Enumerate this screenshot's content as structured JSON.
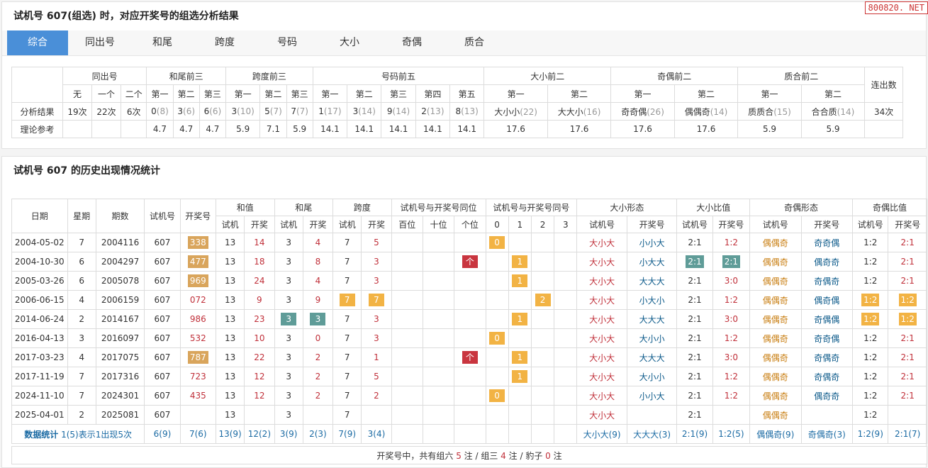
{
  "watermark": "800820. NET",
  "top_title": "试机号 607(组选) 时，对应开奖号的组选分析结果",
  "tabs": [
    "综合",
    "同出号",
    "和尾",
    "跨度",
    "号码",
    "大小",
    "奇偶",
    "质合"
  ],
  "summary": {
    "groups": [
      "同出号",
      "和尾前三",
      "跨度前三",
      "号码前五",
      "大小前二",
      "奇偶前二",
      "质合前二",
      "连出数"
    ],
    "sub_tongchu": [
      "无",
      "一个",
      "二个"
    ],
    "sub_ordinals": [
      "第一",
      "第二",
      "第三",
      "第四",
      "第五"
    ],
    "row_result_label": "分析结果",
    "row_ref_label": "理论参考",
    "tongchu_result": [
      "19次",
      "22次",
      "6次"
    ],
    "hewei": [
      {
        "v": "0",
        "c": "8"
      },
      {
        "v": "3",
        "c": "6"
      },
      {
        "v": "6",
        "c": "6"
      }
    ],
    "kuadu": [
      {
        "v": "3",
        "c": "10"
      },
      {
        "v": "5",
        "c": "7"
      },
      {
        "v": "7",
        "c": "7"
      }
    ],
    "haoma": [
      {
        "v": "1",
        "c": "17"
      },
      {
        "v": "3",
        "c": "14"
      },
      {
        "v": "9",
        "c": "14"
      },
      {
        "v": "2",
        "c": "13"
      },
      {
        "v": "8",
        "c": "13"
      }
    ],
    "daxiao": [
      {
        "v": "大小小",
        "c": "22"
      },
      {
        "v": "大大小",
        "c": "16"
      }
    ],
    "jiou": [
      {
        "v": "奇奇偶",
        "c": "26"
      },
      {
        "v": "偶偶奇",
        "c": "14"
      }
    ],
    "zhihe": [
      {
        "v": "质质合",
        "c": "15"
      },
      {
        "v": "合合质",
        "c": "14"
      }
    ],
    "lianchu": "34次",
    "ref": [
      "4.7",
      "4.7",
      "4.7",
      "5.9",
      "7.1",
      "5.9",
      "14.1",
      "14.1",
      "14.1",
      "14.1",
      "14.1",
      "17.6",
      "17.6",
      "17.6",
      "17.6",
      "5.9",
      "5.9"
    ]
  },
  "hist_title": "试机号 607 的历史出现情况统计",
  "hist": {
    "headers": {
      "date": "日期",
      "week": "星期",
      "issue": "期数",
      "sjh": "试机号",
      "kjh": "开奖号",
      "hezhi": "和值",
      "hewei": "和尾",
      "kuadu": "跨度",
      "tongwei": "试机号与开奖号同位",
      "tonghao": "试机号与开奖号同号",
      "dxxt": "大小形态",
      "dxbz": "大小比值",
      "joxt": "奇偶形态",
      "jobz": "奇偶比值",
      "sub_sj": "试机",
      "sub_kj": "开奖",
      "sub_sjh": "试机号",
      "sub_kjh": "开奖号",
      "pos": [
        "百位",
        "十位",
        "个位"
      ],
      "cnt": [
        "0",
        "1",
        "2",
        "3"
      ]
    },
    "rows": [
      {
        "date": "2004-05-02",
        "week": "7",
        "issue": "2004116",
        "sjh": "607",
        "kjh": "338",
        "kjh_hl": true,
        "hz_sj": "13",
        "hz_kj": "14",
        "hw_sj": "3",
        "hw_sj_hl": false,
        "hw_kj": "4",
        "hw_kj_hl": false,
        "kd_sj": "7",
        "kd_sj_hl": false,
        "kd_kj": "5",
        "kd_kj_hl": false,
        "pos": [
          "",
          "",
          ""
        ],
        "cnt_idx": 0,
        "dx_sj": "大小大",
        "dx_kj": "小小大",
        "dxb_sj": "2:1",
        "dxb_kj": "1:2",
        "dxb_hl": false,
        "jo_sj": "偶偶奇",
        "jo_kj": "奇奇偶",
        "job_sj": "1:2",
        "job_kj": "2:1",
        "job_hl": false
      },
      {
        "date": "2004-10-30",
        "week": "6",
        "issue": "2004297",
        "sjh": "607",
        "kjh": "477",
        "kjh_hl": true,
        "hz_sj": "13",
        "hz_kj": "18",
        "hw_sj": "3",
        "hw_sj_hl": false,
        "hw_kj": "8",
        "hw_kj_hl": false,
        "kd_sj": "7",
        "kd_sj_hl": false,
        "kd_kj": "3",
        "kd_kj_hl": false,
        "pos": [
          "",
          "",
          "个"
        ],
        "cnt_idx": 1,
        "dx_sj": "大小大",
        "dx_kj": "小大大",
        "dxb_sj": "2:1",
        "dxb_kj": "2:1",
        "dxb_hl": true,
        "jo_sj": "偶偶奇",
        "jo_kj": "偶奇奇",
        "job_sj": "1:2",
        "job_kj": "2:1",
        "job_hl": false
      },
      {
        "date": "2005-03-26",
        "week": "6",
        "issue": "2005078",
        "sjh": "607",
        "kjh": "969",
        "kjh_hl": true,
        "hz_sj": "13",
        "hz_kj": "24",
        "hw_sj": "3",
        "hw_sj_hl": false,
        "hw_kj": "4",
        "hw_kj_hl": false,
        "kd_sj": "7",
        "kd_sj_hl": false,
        "kd_kj": "3",
        "kd_kj_hl": false,
        "pos": [
          "",
          "",
          ""
        ],
        "cnt_idx": 1,
        "dx_sj": "大小大",
        "dx_kj": "大大大",
        "dxb_sj": "2:1",
        "dxb_kj": "3:0",
        "dxb_hl": false,
        "jo_sj": "偶偶奇",
        "jo_kj": "奇偶奇",
        "job_sj": "1:2",
        "job_kj": "2:1",
        "job_hl": false
      },
      {
        "date": "2006-06-15",
        "week": "4",
        "issue": "2006159",
        "sjh": "607",
        "kjh": "072",
        "kjh_hl": false,
        "hz_sj": "13",
        "hz_kj": "9",
        "hw_sj": "3",
        "hw_sj_hl": false,
        "hw_kj": "9",
        "hw_kj_hl": false,
        "kd_sj": "7",
        "kd_sj_hl": true,
        "kd_kj": "7",
        "kd_kj_hl": true,
        "pos": [
          "",
          "",
          ""
        ],
        "cnt_idx": 2,
        "dx_sj": "大小大",
        "dx_kj": "小大小",
        "dxb_sj": "2:1",
        "dxb_kj": "1:2",
        "dxb_hl": false,
        "jo_sj": "偶偶奇",
        "jo_kj": "偶奇偶",
        "job_sj": "1:2",
        "job_kj": "1:2",
        "job_hl": true
      },
      {
        "date": "2014-06-24",
        "week": "2",
        "issue": "2014167",
        "sjh": "607",
        "kjh": "986",
        "kjh_hl": false,
        "hz_sj": "13",
        "hz_kj": "23",
        "hw_sj": "3",
        "hw_sj_hl": true,
        "hw_kj": "3",
        "hw_kj_hl": true,
        "kd_sj": "7",
        "kd_sj_hl": false,
        "kd_kj": "3",
        "kd_kj_hl": false,
        "pos": [
          "",
          "",
          ""
        ],
        "cnt_idx": 1,
        "dx_sj": "大小大",
        "dx_kj": "大大大",
        "dxb_sj": "2:1",
        "dxb_kj": "3:0",
        "dxb_hl": false,
        "jo_sj": "偶偶奇",
        "jo_kj": "奇偶偶",
        "job_sj": "1:2",
        "job_kj": "1:2",
        "job_hl": true
      },
      {
        "date": "2016-04-13",
        "week": "3",
        "issue": "2016097",
        "sjh": "607",
        "kjh": "532",
        "kjh_hl": false,
        "hz_sj": "13",
        "hz_kj": "10",
        "hw_sj": "3",
        "hw_sj_hl": false,
        "hw_kj": "0",
        "hw_kj_hl": false,
        "kd_sj": "7",
        "kd_sj_hl": false,
        "kd_kj": "3",
        "kd_kj_hl": false,
        "pos": [
          "",
          "",
          ""
        ],
        "cnt_idx": 0,
        "dx_sj": "大小大",
        "dx_kj": "大小小",
        "dxb_sj": "2:1",
        "dxb_kj": "1:2",
        "dxb_hl": false,
        "jo_sj": "偶偶奇",
        "jo_kj": "奇奇偶",
        "job_sj": "1:2",
        "job_kj": "2:1",
        "job_hl": false
      },
      {
        "date": "2017-03-23",
        "week": "4",
        "issue": "2017075",
        "sjh": "607",
        "kjh": "787",
        "kjh_hl": true,
        "hz_sj": "13",
        "hz_kj": "22",
        "hw_sj": "3",
        "hw_sj_hl": false,
        "hw_kj": "2",
        "hw_kj_hl": false,
        "kd_sj": "7",
        "kd_sj_hl": false,
        "kd_kj": "1",
        "kd_kj_hl": false,
        "pos": [
          "",
          "",
          "个"
        ],
        "cnt_idx": 1,
        "dx_sj": "大小大",
        "dx_kj": "大大大",
        "dxb_sj": "2:1",
        "dxb_kj": "3:0",
        "dxb_hl": false,
        "jo_sj": "偶偶奇",
        "jo_kj": "奇偶奇",
        "job_sj": "1:2",
        "job_kj": "2:1",
        "job_hl": false
      },
      {
        "date": "2017-11-19",
        "week": "7",
        "issue": "2017316",
        "sjh": "607",
        "kjh": "723",
        "kjh_hl": false,
        "hz_sj": "13",
        "hz_kj": "12",
        "hw_sj": "3",
        "hw_sj_hl": false,
        "hw_kj": "2",
        "hw_kj_hl": false,
        "kd_sj": "7",
        "kd_sj_hl": false,
        "kd_kj": "5",
        "kd_kj_hl": false,
        "pos": [
          "",
          "",
          ""
        ],
        "cnt_idx": 1,
        "dx_sj": "大小大",
        "dx_kj": "大小小",
        "dxb_sj": "2:1",
        "dxb_kj": "1:2",
        "dxb_hl": false,
        "jo_sj": "偶偶奇",
        "jo_kj": "奇偶奇",
        "job_sj": "1:2",
        "job_kj": "2:1",
        "job_hl": false
      },
      {
        "date": "2024-11-10",
        "week": "7",
        "issue": "2024301",
        "sjh": "607",
        "kjh": "435",
        "kjh_hl": false,
        "hz_sj": "13",
        "hz_kj": "12",
        "hw_sj": "3",
        "hw_sj_hl": false,
        "hw_kj": "2",
        "hw_kj_hl": false,
        "kd_sj": "7",
        "kd_sj_hl": false,
        "kd_kj": "2",
        "kd_kj_hl": false,
        "pos": [
          "",
          "",
          ""
        ],
        "cnt_idx": 0,
        "dx_sj": "大小大",
        "dx_kj": "小小大",
        "dxb_sj": "2:1",
        "dxb_kj": "1:2",
        "dxb_hl": false,
        "jo_sj": "偶偶奇",
        "jo_kj": "偶奇奇",
        "job_sj": "1:2",
        "job_kj": "2:1",
        "job_hl": false
      },
      {
        "date": "2025-04-01",
        "week": "2",
        "issue": "2025081",
        "sjh": "607",
        "kjh": "",
        "kjh_hl": false,
        "hz_sj": "13",
        "hz_kj": "",
        "hw_sj": "3",
        "hw_sj_hl": false,
        "hw_kj": "",
        "hw_kj_hl": false,
        "kd_sj": "7",
        "kd_sj_hl": false,
        "kd_kj": "",
        "kd_kj_hl": false,
        "pos": [
          "",
          "",
          ""
        ],
        "cnt_idx": -1,
        "dx_sj": "大小大",
        "dx_kj": "",
        "dxb_sj": "2:1",
        "dxb_kj": "",
        "dxb_hl": false,
        "jo_sj": "偶偶奇",
        "jo_kj": "",
        "job_sj": "1:2",
        "job_kj": "",
        "job_hl": false
      }
    ],
    "stat": {
      "label": "数据统计",
      "note": "1(5)表示1出现5次",
      "sjh": "6(9)",
      "kjh": "7(6)",
      "hz_sj": "13(9)",
      "hz_kj": "12(2)",
      "hw_sj": "3(9)",
      "hw_kj": "2(3)",
      "kd_sj": "7(9)",
      "kd_kj": "3(4)",
      "dx_sj": "大小大(9)",
      "dx_kj": "大大大(3)",
      "dxb_sj": "2:1(9)",
      "dxb_kj": "1:2(5)",
      "jo_sj": "偶偶奇(9)",
      "jo_kj": "奇偶奇(3)",
      "job_sj": "1:2(9)",
      "job_kj": "2:1(7)"
    },
    "footer": {
      "pre": "开奖号中，共有组六",
      "n6": "5",
      "mid1": "注 / 组三",
      "n3": "4",
      "mid2": "注 / 豹子",
      "nb": "0",
      "post": "注"
    }
  }
}
